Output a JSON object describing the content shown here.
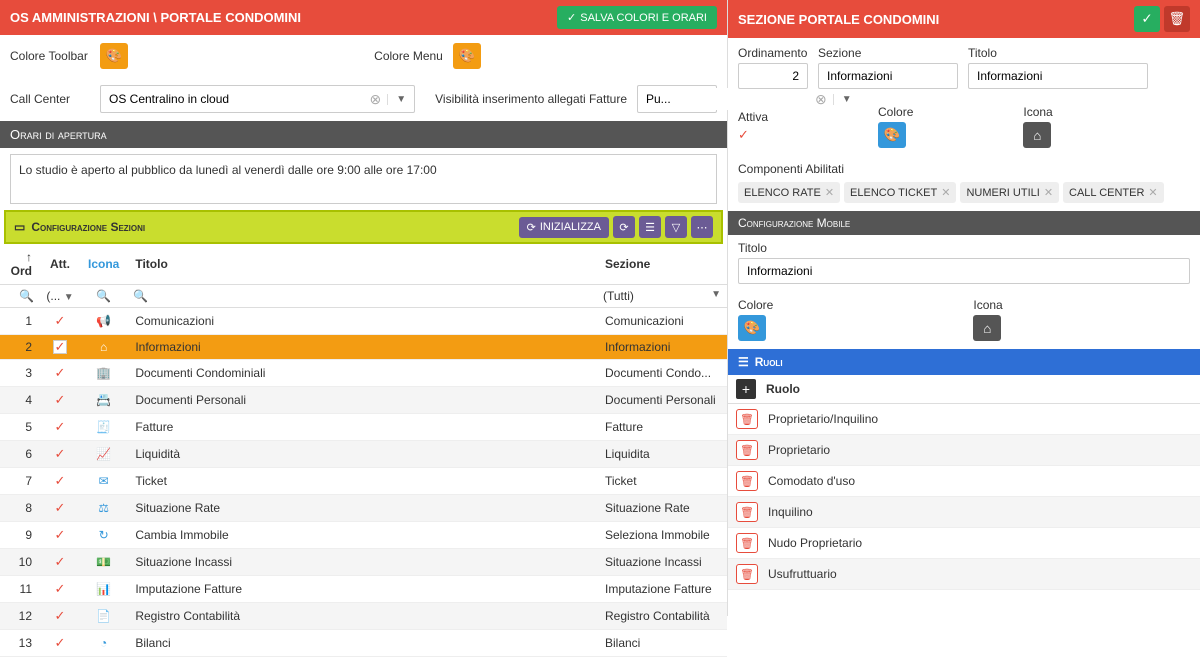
{
  "left": {
    "header": {
      "title": "OS AMMINISTRAZIONI \\ PORTALE CONDOMINI",
      "save_btn": "SALVA COLORI E ORARI"
    },
    "form": {
      "color_toolbar_lbl": "Colore Toolbar",
      "color_menu_lbl": "Colore Menu",
      "call_center_lbl": "Call Center",
      "call_center_val": "OS Centralino in cloud",
      "visibilita_lbl": "Visibilità inserimento allegati Fatture",
      "visibilita_val": "Pu..."
    },
    "orari": {
      "hdr": "Orari di apertura",
      "text": "Lo studio è aperto al pubblico da lunedì al venerdì dalle ore 9:00 alle ore 17:00"
    },
    "sezioni": {
      "hdr": "Configurazione Sezioni",
      "init_btn": "INIZIALIZZA",
      "cols": {
        "ord": "Ord",
        "att": "Att.",
        "icona": "Icona",
        "titolo": "Titolo",
        "sezione": "Sezione"
      },
      "filter": {
        "att": "(...",
        "sezione": "(Tutti)"
      },
      "rows": [
        {
          "ord": "1",
          "titolo": "Comunicazioni",
          "sezione": "Comunicazioni",
          "icon": "📢",
          "sel": false
        },
        {
          "ord": "2",
          "titolo": "Informazioni",
          "sezione": "Informazioni",
          "icon": "⌂",
          "sel": true
        },
        {
          "ord": "3",
          "titolo": "Documenti Condominiali",
          "sezione": "Documenti Condo...",
          "icon": "🏢",
          "sel": false
        },
        {
          "ord": "4",
          "titolo": "Documenti Personali",
          "sezione": "Documenti Personali",
          "icon": "📇",
          "sel": false
        },
        {
          "ord": "5",
          "titolo": "Fatture",
          "sezione": "Fatture",
          "icon": "🧾",
          "sel": false
        },
        {
          "ord": "6",
          "titolo": "Liquidità",
          "sezione": "Liquidita",
          "icon": "📈",
          "sel": false
        },
        {
          "ord": "7",
          "titolo": "Ticket",
          "sezione": "Ticket",
          "icon": "✉",
          "sel": false
        },
        {
          "ord": "8",
          "titolo": "Situazione Rate",
          "sezione": "Situazione Rate",
          "icon": "⚖",
          "sel": false
        },
        {
          "ord": "9",
          "titolo": "Cambia Immobile",
          "sezione": "Seleziona Immobile",
          "icon": "↻",
          "sel": false
        },
        {
          "ord": "10",
          "titolo": "Situazione Incassi",
          "sezione": "Situazione Incassi",
          "icon": "💵",
          "sel": false
        },
        {
          "ord": "11",
          "titolo": "Imputazione Fatture",
          "sezione": "Imputazione Fatture",
          "icon": "📊",
          "sel": false
        },
        {
          "ord": "12",
          "titolo": "Registro Contabilità",
          "sezione": "Registro Contabilità",
          "icon": "📄",
          "sel": false
        },
        {
          "ord": "13",
          "titolo": "Bilanci",
          "sezione": "Bilanci",
          "icon": "◔",
          "sel": false
        }
      ]
    }
  },
  "right": {
    "header": {
      "title": "SEZIONE PORTALE CONDOMINI"
    },
    "form": {
      "ordinamento_lbl": "Ordinamento",
      "ordinamento_val": "2",
      "sezione_lbl": "Sezione",
      "sezione_val": "Informazioni",
      "titolo_lbl": "Titolo",
      "titolo_val": "Informazioni",
      "attiva_lbl": "Attiva",
      "colore_lbl": "Colore",
      "icona_lbl": "Icona"
    },
    "componenti": {
      "lbl": "Componenti Abilitati",
      "tags": [
        "ELENCO RATE",
        "ELENCO TICKET",
        "NUMERI UTILI",
        "CALL CENTER"
      ]
    },
    "mobile": {
      "hdr": "Configurazione Mobile",
      "titolo_lbl": "Titolo",
      "titolo_val": "Informazioni",
      "colore_lbl": "Colore",
      "icona_lbl": "Icona"
    },
    "ruoli": {
      "hdr": "Ruoli",
      "col": "Ruolo",
      "rows": [
        "Proprietario/Inquilino",
        "Proprietario",
        "Comodato d'uso",
        "Inquilino",
        "Nudo Proprietario",
        "Usufruttuario"
      ]
    }
  }
}
